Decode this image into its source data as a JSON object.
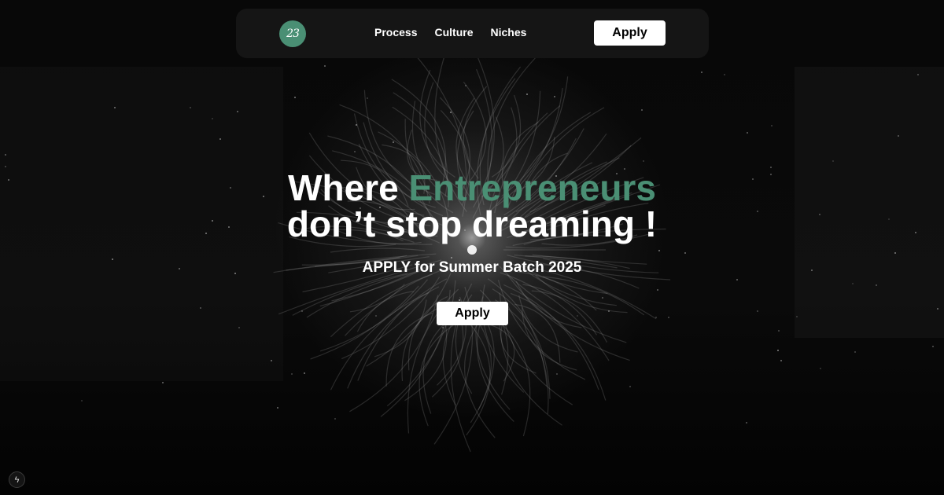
{
  "navbar": {
    "logo_text": "23",
    "links": [
      "Process",
      "Culture",
      "Niches"
    ],
    "apply_label": "Apply"
  },
  "hero": {
    "headline_prefix": "Where ",
    "headline_accent": "Entrepreneurs",
    "headline_line2": "don’t stop dreaming !",
    "subheadline": "APPLY for Summer Batch 2025",
    "apply_label": "Apply"
  },
  "corner_badge": {
    "icon": "lightning-icon",
    "glyph": "ϟ"
  },
  "colors": {
    "accent": "#4a8f74",
    "background": "#000000",
    "navbar_bg": "#151515",
    "button_bg": "#ffffff"
  }
}
